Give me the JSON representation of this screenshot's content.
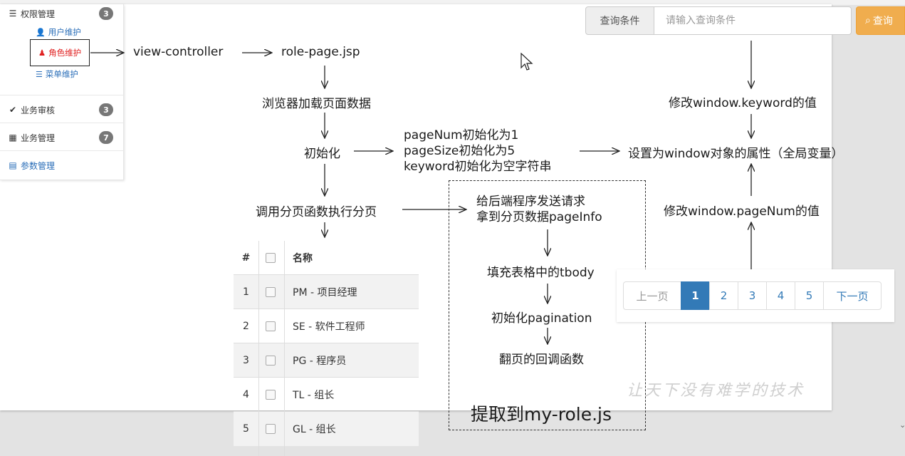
{
  "sidebar": {
    "items": [
      {
        "icon": "server-icon",
        "label": "权限管理",
        "badge": "3"
      },
      {
        "icon": "check-icon",
        "label": "业务审核",
        "badge": "3"
      },
      {
        "icon": "grid-icon",
        "label": "业务管理",
        "badge": "7"
      },
      {
        "icon": "list-icon",
        "label": "参数管理"
      }
    ],
    "subitems": [
      {
        "icon": "user-icon",
        "label": "用户维护"
      },
      {
        "icon": "user-role-icon",
        "label": "角色维护"
      },
      {
        "icon": "menu-icon",
        "label": "菜单维护"
      }
    ]
  },
  "search": {
    "label": "查询条件",
    "placeholder": "请输入查询条件",
    "button": "查询"
  },
  "diagram": {
    "view_controller": "view-controller",
    "role_page": "role-page.jsp",
    "browser_load": "浏览器加载页面数据",
    "init": "初始化",
    "init_lines": [
      "pageNum初始化为1",
      "pageSize初始化为5",
      "keyword初始化为空字符串"
    ],
    "set_window": "设置为window对象的属性（全局变量）",
    "modify_keyword": "修改window.keyword的值",
    "modify_pagenum": "修改window.pageNum的值",
    "call_paging": "调用分页函数执行分页",
    "send_request": "给后端程序发送请求",
    "get_pageinfo": "拿到分页数据pageInfo",
    "fill_tbody": "填充表格中的tbody",
    "init_pagination": "初始化pagination",
    "callback": "翻页的回调函数",
    "extract": "提取到my-role.js"
  },
  "table": {
    "headers": [
      "#",
      "名称"
    ],
    "rows": [
      {
        "num": "1",
        "name": "PM - 项目经理"
      },
      {
        "num": "2",
        "name": "SE - 软件工程师"
      },
      {
        "num": "3",
        "name": "PG - 程序员"
      },
      {
        "num": "4",
        "name": "TL - 组长"
      },
      {
        "num": "5",
        "name": "GL - 组长"
      }
    ]
  },
  "pagination": {
    "prev": "上一页",
    "pages": [
      "1",
      "2",
      "3",
      "4",
      "5"
    ],
    "active": "1",
    "next": "下一页"
  },
  "watermark": "让天下没有难学的技术"
}
